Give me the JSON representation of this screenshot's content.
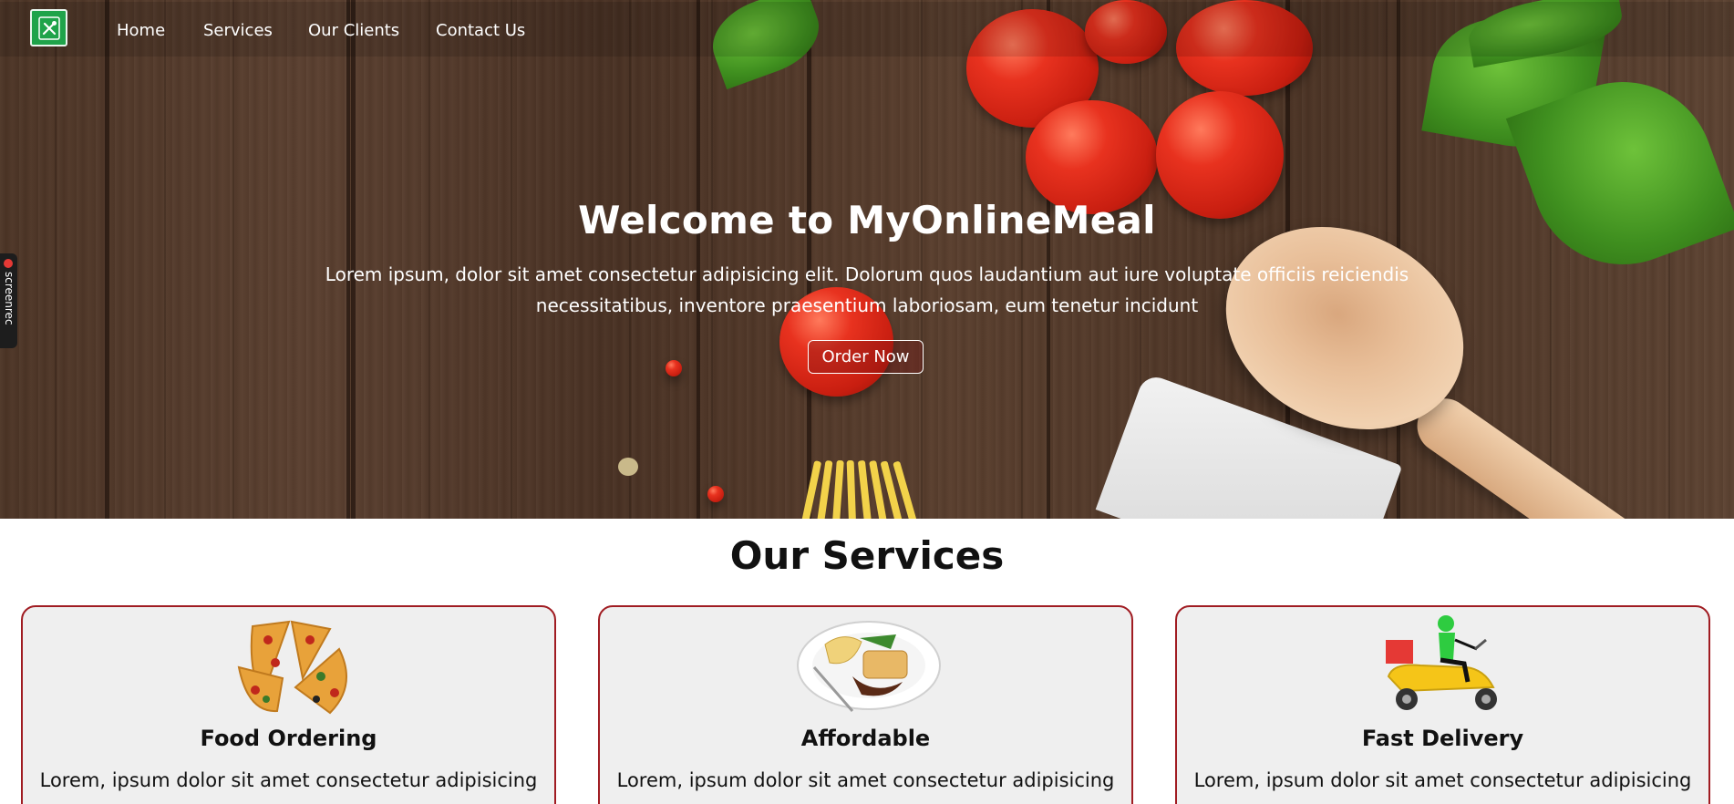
{
  "nav": {
    "logo_alt": "MyOnlineMeal logo",
    "links": [
      "Home",
      "Services",
      "Our Clients",
      "Contact Us"
    ]
  },
  "hero": {
    "title": "Welcome to MyOnlineMeal",
    "text_line1": "Lorem ipsum, dolor sit amet consectetur adipisicing elit. Dolorum quos laudantium aut iure voluptate officiis reiciendis",
    "text_line2": "necessitatibus, inventore praesentium laboriosam, eum tenetur incidunt",
    "button": "Order Now"
  },
  "screenrec": {
    "label": "screenrec"
  },
  "services": {
    "heading": "Our Services",
    "cards": [
      {
        "title": "Food Ordering",
        "text": "Lorem, ipsum dolor sit amet consectetur adipisicing",
        "icon": "pizza-icon"
      },
      {
        "title": "Affordable",
        "text": "Lorem, ipsum dolor sit amet consectetur adipisicing",
        "icon": "meal-plate-icon"
      },
      {
        "title": "Fast Delivery",
        "text": "Lorem, ipsum dolor sit amet consectetur adipisicing",
        "icon": "delivery-scooter-icon"
      }
    ]
  },
  "colors": {
    "logo_green": "#1fa34a",
    "card_border": "#a01c22",
    "card_bg": "#efefef"
  }
}
